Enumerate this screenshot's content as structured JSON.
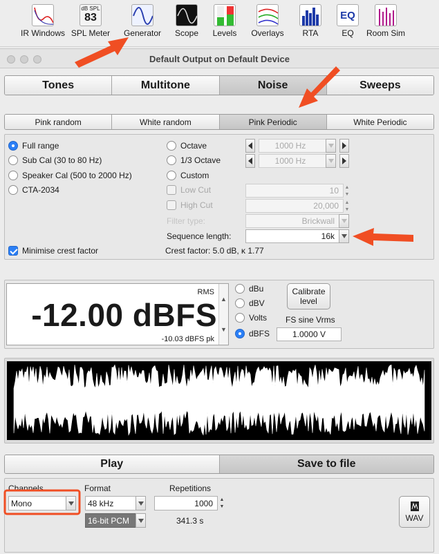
{
  "toolbar": {
    "items": [
      {
        "label": "IR Windows",
        "icon": "ir-windows-icon"
      },
      {
        "label": "SPL Meter",
        "icon": "spl-meter-icon",
        "top_text": "dB SPL",
        "reading": "83"
      },
      {
        "label": "Generator",
        "icon": "generator-icon"
      },
      {
        "label": "Scope",
        "icon": "scope-icon"
      },
      {
        "label": "Levels",
        "icon": "levels-icon"
      },
      {
        "label": "Overlays",
        "icon": "overlays-icon"
      },
      {
        "label": "RTA",
        "icon": "rta-icon"
      },
      {
        "label": "EQ",
        "icon": "eq-icon",
        "top_text": "EQ"
      },
      {
        "label": "Room Sim",
        "icon": "room-sim-icon"
      }
    ]
  },
  "window": {
    "title": "Default Output on Default Device"
  },
  "main_tabs": {
    "items": [
      "Tones",
      "Multitone",
      "Noise",
      "Sweeps"
    ],
    "active": "Noise"
  },
  "sub_tabs": {
    "items": [
      "Pink random",
      "White random",
      "Pink Periodic",
      "White Periodic"
    ],
    "active": "Pink Periodic"
  },
  "noise": {
    "range_options": [
      "Full range",
      "Sub Cal (30 to 80 Hz)",
      "Speaker Cal (500 to 2000 Hz)",
      "CTA-2034"
    ],
    "range_selected": "Full range",
    "band_options": [
      "Octave",
      "1/3 Octave",
      "Custom"
    ],
    "octave_freq": "1000 Hz",
    "third_octave_freq": "1000 Hz",
    "low_cut_label": "Low Cut",
    "low_cut_value": "10",
    "high_cut_label": "High Cut",
    "high_cut_value": "20,000",
    "filter_type_label": "Filter type:",
    "filter_type_value": "Brickwall",
    "sequence_length_label": "Sequence length:",
    "sequence_length_value": "16k",
    "minimise_crest_label": "Minimise crest factor",
    "minimise_crest_checked": true,
    "crest_factor_text": "Crest factor: 5.0 dB, κ 1.77"
  },
  "level": {
    "rms_label": "RMS",
    "value": "-12.00 dBFS",
    "peak": "-10.03 dBFS pk",
    "units": [
      "dBu",
      "dBV",
      "Volts",
      "dBFS"
    ],
    "unit_selected": "dBFS",
    "calibrate_label": "Calibrate level",
    "fs_sine_label": "FS sine Vrms",
    "fs_sine_value": "1.0000 V"
  },
  "actions": {
    "play_label": "Play",
    "save_label": "Save to file"
  },
  "output": {
    "channels_label": "Channels",
    "channels_value": "Mono",
    "format_label": "Format",
    "sample_rate": "48 kHz",
    "bit_depth": "16-bit PCM",
    "repetitions_label": "Repetitions",
    "repetitions_value": "1000",
    "duration": "341.3 s",
    "wav_label": "WAV"
  },
  "colors": {
    "accent": "#2b7ff6",
    "annotation": "#f04e23",
    "waveform_bg": "#000000",
    "waveform_fg": "#ffffff"
  }
}
